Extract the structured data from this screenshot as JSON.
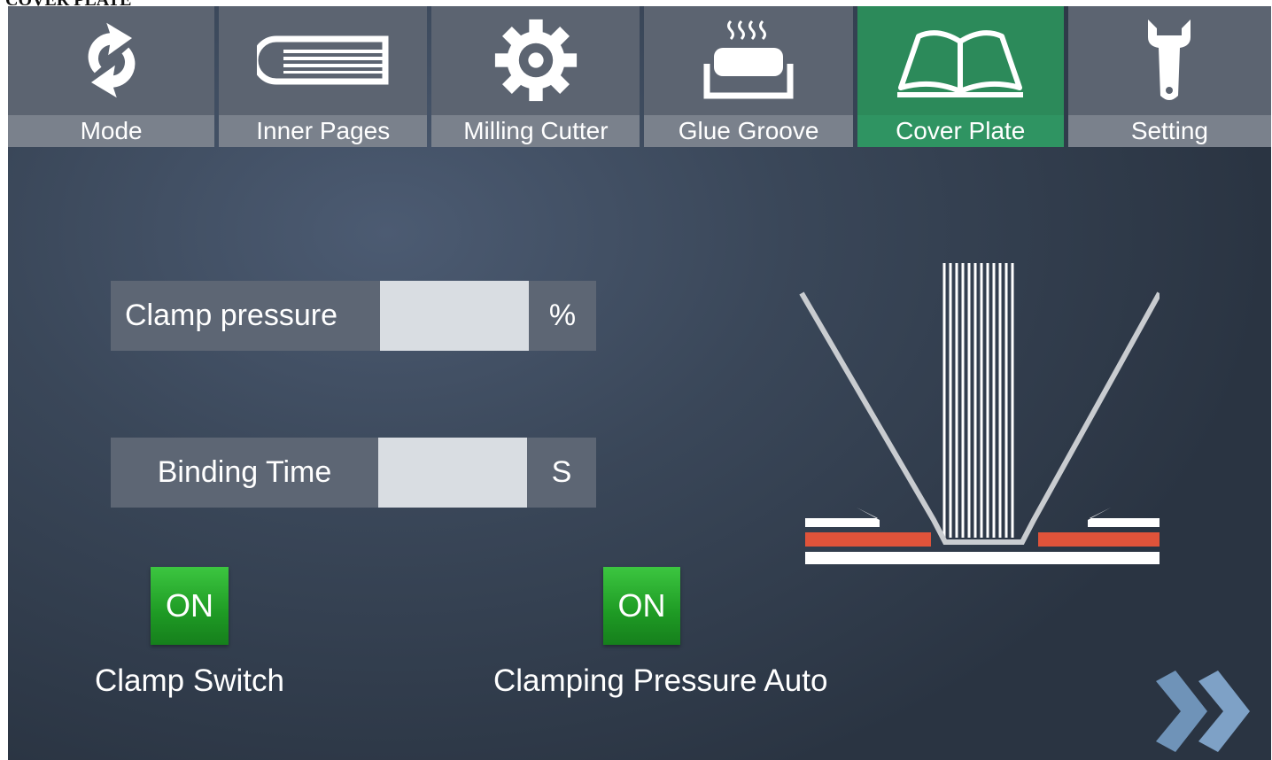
{
  "page": {
    "caption": "COVER PLATE"
  },
  "tabs": [
    {
      "id": "mode",
      "label": "Mode",
      "icon": "refresh-icon",
      "active": false
    },
    {
      "id": "inner-pages",
      "label": "Inner Pages",
      "icon": "book-stack-icon",
      "active": false
    },
    {
      "id": "milling-cutter",
      "label": "Milling Cutter",
      "icon": "gear-icon",
      "active": false
    },
    {
      "id": "glue-groove",
      "label": "Glue Groove",
      "icon": "heated-tray-icon",
      "active": false
    },
    {
      "id": "cover-plate",
      "label": "Cover Plate",
      "icon": "open-book-icon",
      "active": true
    },
    {
      "id": "setting",
      "label": "Setting",
      "icon": "wrench-icon",
      "active": false
    }
  ],
  "fields": {
    "clamp_pressure": {
      "label": "Clamp pressure",
      "value": "",
      "unit": "%"
    },
    "binding_time": {
      "label": "Binding Time",
      "value": "",
      "unit": "S"
    }
  },
  "toggles": {
    "clamp_switch": {
      "state": "ON",
      "label": "Clamp Switch"
    },
    "clamping_pressure_auto": {
      "state": "ON",
      "label": "Clamping Pressure Auto"
    }
  },
  "colors": {
    "accent_active_tab": "#2c8a5a",
    "toggle_on": "#1e9a24",
    "clamp_red": "#e0533a"
  },
  "navigation": {
    "next_icon": "double-chevron-right-icon"
  }
}
